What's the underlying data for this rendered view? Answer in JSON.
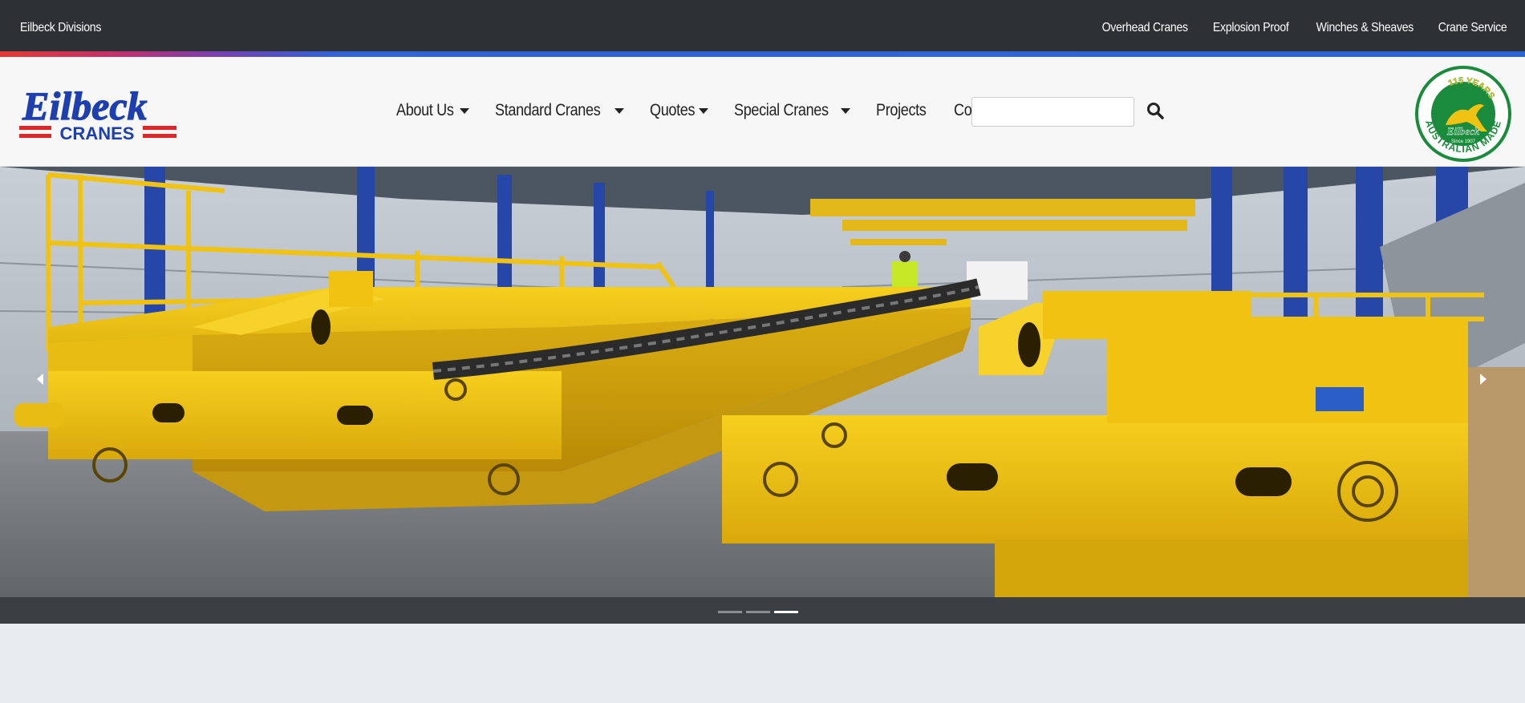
{
  "topbar": {
    "brand": "Eilbeck Divisions",
    "links": [
      "Overhead Cranes",
      "Explosion Proof",
      "Winches & Sheaves",
      "Crane Service"
    ]
  },
  "logo": {
    "top": "Eilbeck",
    "bottom": "CRANES"
  },
  "nav": {
    "items": [
      {
        "label": "About Us",
        "dropdown": true
      },
      {
        "label": "Standard Cranes",
        "dropdown": true
      },
      {
        "label": "Quotes",
        "dropdown": true
      },
      {
        "label": "Special Cranes",
        "dropdown": true
      },
      {
        "label": "Projects",
        "dropdown": false
      },
      {
        "label": "Contact",
        "dropdown": false
      }
    ],
    "search_value": ""
  },
  "badge": {
    "years": "115 YEARS",
    "made": "AUSTRALIAN MADE",
    "brand": "Eilbeck",
    "since": "Since 1907"
  },
  "carousel": {
    "slides": 3,
    "active": 3
  },
  "colors": {
    "topbar": "#2e3133",
    "logo_blue": "#1e3fae",
    "logo_red": "#e0262b",
    "crane_yellow": "#f0c313",
    "badge_green": "#1a8a3c"
  },
  "icons": {
    "search": "search-icon",
    "prev": "chevron-left-icon",
    "next": "chevron-right-icon"
  }
}
